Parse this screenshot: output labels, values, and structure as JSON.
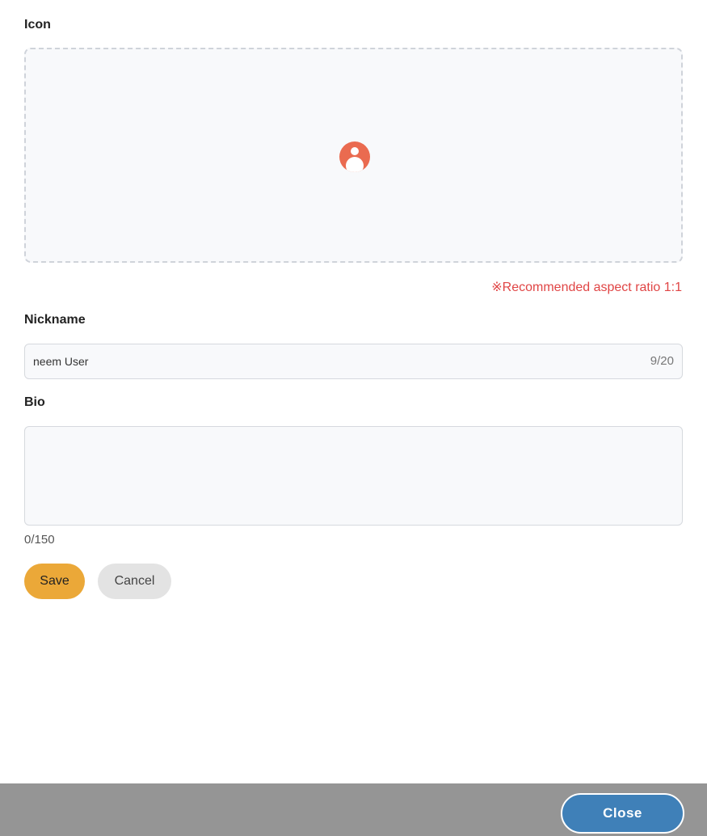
{
  "form": {
    "icon": {
      "label": "Icon",
      "placeholder_icon": "user-avatar-icon",
      "hint": "※Recommended aspect ratio 1:1"
    },
    "nickname": {
      "label": "Nickname",
      "value": "neem User",
      "counter": "9/20"
    },
    "bio": {
      "label": "Bio",
      "value": "",
      "counter": "0/150"
    },
    "actions": {
      "save_label": "Save",
      "cancel_label": "Cancel"
    }
  },
  "footer": {
    "close_label": "Close"
  },
  "colors": {
    "avatar": "#ea6b50",
    "hint": "#e04545",
    "save_button": "#eba838",
    "cancel_button": "#e3e3e3",
    "footer_bar": "#959595",
    "close_button": "#3f80b8"
  }
}
